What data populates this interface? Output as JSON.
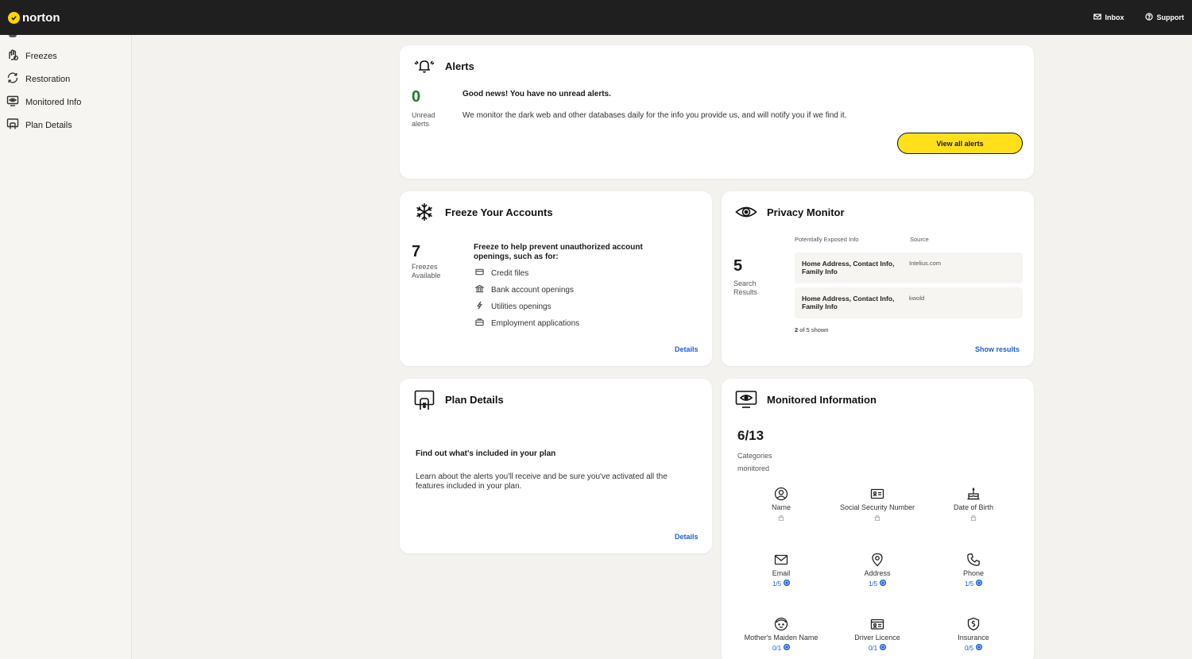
{
  "topbar": {
    "brand": "norton",
    "inbox_label": "Inbox",
    "support_label": "Support"
  },
  "sidebar": {
    "items": [
      {
        "label": "Freezes",
        "icon": "freeze-hand-icon"
      },
      {
        "label": "Restoration",
        "icon": "restore-icon"
      },
      {
        "label": "Monitored Info",
        "icon": "monitor-eye-icon"
      },
      {
        "label": "Plan Details",
        "icon": "plan-icon"
      }
    ]
  },
  "alerts": {
    "title": "Alerts",
    "count": "0",
    "count_label_1": "Unread",
    "count_label_2": "alerts",
    "headline": "Good news! You have no unread alerts.",
    "description": "We monitor the dark web and other databases daily for the info you provide us, and will notify you if we find it.",
    "button": "View all alerts"
  },
  "freeze": {
    "title": "Freeze Your Accounts",
    "count": "7",
    "count_label_1": "Freezes",
    "count_label_2": "Available",
    "headline": "Freeze to help prevent unauthorized account openings, such as for:",
    "items": [
      {
        "label": "Credit files",
        "icon": "credit-card-icon"
      },
      {
        "label": "Bank account openings",
        "icon": "bank-icon"
      },
      {
        "label": "Utilities openings",
        "icon": "bolt-icon"
      },
      {
        "label": "Employment applications",
        "icon": "briefcase-icon"
      }
    ],
    "link": "Details"
  },
  "privacy": {
    "title": "Privacy Monitor",
    "col_info": "Potentially Exposed Info",
    "col_source": "Source",
    "count": "5",
    "count_label_1": "Search",
    "count_label_2": "Results",
    "rows": [
      {
        "info": "Home Address, Contact Info, Family Info",
        "source": "Intelius.com"
      },
      {
        "info": "Home Address, Contact Info, Family Info",
        "source": "kwold"
      }
    ],
    "shown_count": "2",
    "shown_text": "of 5 shown",
    "link": "Show results"
  },
  "plan": {
    "title": "Plan Details",
    "headline": "Find out what's included in your plan",
    "description": "Learn about the alerts you'll receive and be sure you've activated all the features included in your plan.",
    "link": "Details"
  },
  "monitored": {
    "title": "Monitored Information",
    "count": "6/13",
    "count_label_1": "Categories",
    "count_label_2": "monitored",
    "items": [
      {
        "name": "Name",
        "sub": "",
        "locked": true,
        "icon": "user-icon"
      },
      {
        "name": "Social Security Number",
        "sub": "",
        "locked": true,
        "icon": "id-card-icon"
      },
      {
        "name": "Date of Birth",
        "sub": "",
        "locked": true,
        "icon": "cake-icon"
      },
      {
        "name": "Email",
        "sub": "1/5",
        "locked": false,
        "icon": "envelope-icon"
      },
      {
        "name": "Address",
        "sub": "1/5",
        "locked": false,
        "icon": "location-pin-icon"
      },
      {
        "name": "Phone",
        "sub": "1/5",
        "locked": false,
        "icon": "phone-icon"
      },
      {
        "name": "Mother's Maiden Name",
        "sub": "0/1",
        "locked": false,
        "icon": "face-icon"
      },
      {
        "name": "Driver Licence",
        "sub": "0/1",
        "locked": false,
        "icon": "license-icon"
      },
      {
        "name": "Insurance",
        "sub": "0/5",
        "locked": false,
        "icon": "shield-dollar-icon"
      }
    ]
  },
  "colors": {
    "accent_yellow": "#ffe01a",
    "link_blue": "#1a5fd6",
    "topbar": "#1f1f1f",
    "background": "#f3f2ef"
  }
}
